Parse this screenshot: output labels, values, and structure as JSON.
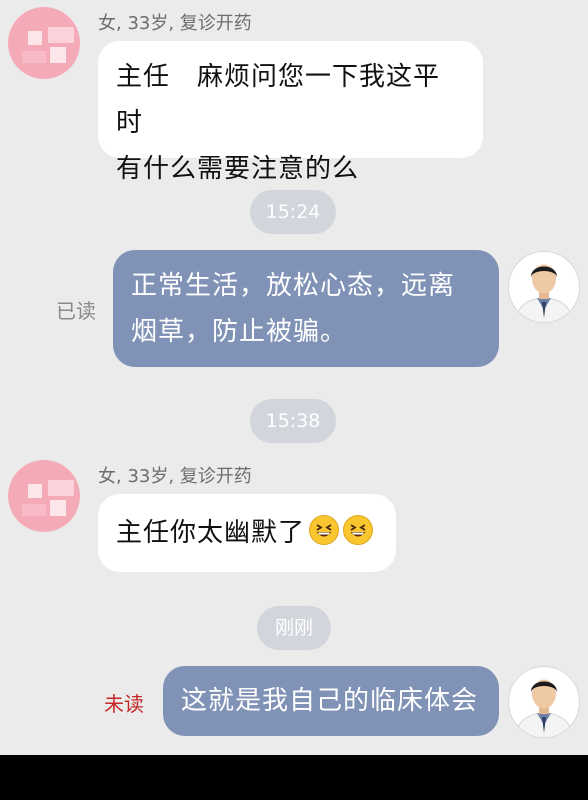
{
  "colors": {
    "background": "#ebebeb",
    "incoming_bubble": "#ffffff",
    "outgoing_bubble": "#8093b7",
    "time_pill": "#d2d5dc",
    "read_text": "#8a8a8a",
    "unread_text": "#c62828",
    "patient_avatar": "#f5aab7"
  },
  "messages": [
    {
      "type": "incoming",
      "sender_info": "女, 33岁, 复诊开药",
      "lines": [
        "主任　麻烦问您一下我这平时",
        "有什么需要注意的么"
      ]
    },
    {
      "type": "time",
      "label": "15:24"
    },
    {
      "type": "outgoing",
      "status": "已读",
      "lines": [
        "正常生活，放松心态，远离",
        "烟草，防止被骗。"
      ]
    },
    {
      "type": "time",
      "label": "15:38"
    },
    {
      "type": "incoming",
      "sender_info": "女, 33岁, 复诊开药",
      "text": "主任你太幽默了",
      "emojis": [
        "grinning-squint-emoji",
        "grinning-squint-emoji"
      ]
    },
    {
      "type": "time",
      "label": "刚刚"
    },
    {
      "type": "outgoing",
      "status": "未读",
      "text": "这就是我自己的临床体会"
    }
  ]
}
